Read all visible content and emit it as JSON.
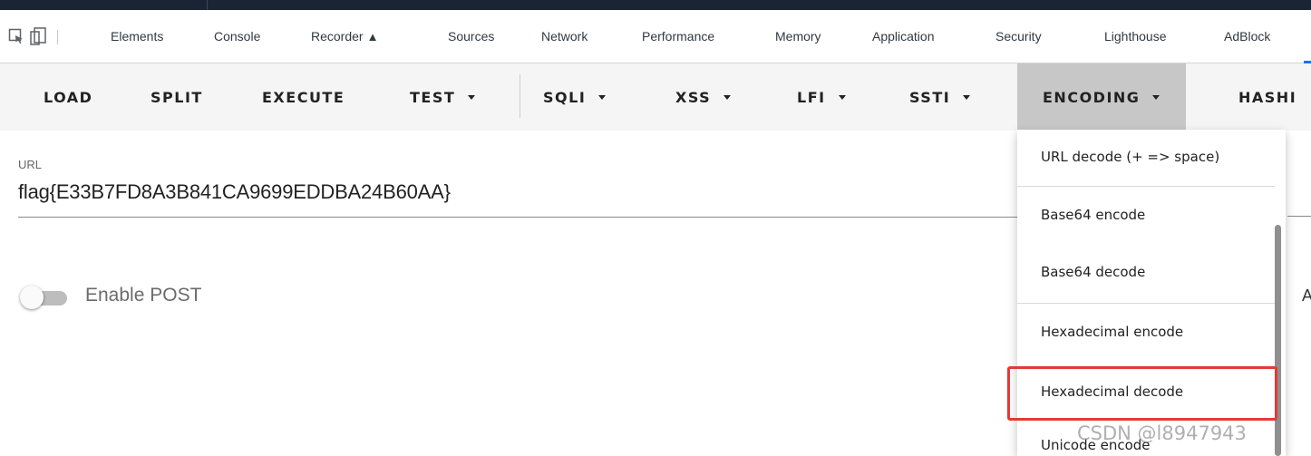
{
  "devtools": {
    "tabs": [
      "Elements",
      "Console",
      "Recorder",
      "Sources",
      "Network",
      "Performance",
      "Memory",
      "Application",
      "Security",
      "Lighthouse",
      "AdBlock"
    ]
  },
  "toolbar": {
    "load": "LOAD",
    "split": "SPLIT",
    "execute": "EXECUTE",
    "test": "TEST",
    "sqli": "SQLI",
    "xss": "XSS",
    "lfi": "LFI",
    "ssti": "SSTI",
    "encoding": "ENCODING",
    "hashing": "HASHI"
  },
  "url": {
    "label": "URL",
    "value": "flag{E33B7FD8A3B841CA9699EDDBA24B60AA}"
  },
  "post": {
    "label": "Enable POST",
    "enabled": false
  },
  "right_edge_letter": "A",
  "encoding_menu": {
    "items": [
      "URL decode (+ => space)",
      "Base64 encode",
      "Base64 decode",
      "Hexadecimal encode",
      "Hexadecimal decode",
      "Unicode encode"
    ],
    "highlighted": "Hexadecimal decode"
  },
  "watermark": "CSDN @l8947943",
  "colors": {
    "highlight_border": "#e53935",
    "toolbar_bg": "#f5f5f5",
    "active_menu_bg": "#c7c7c7"
  }
}
